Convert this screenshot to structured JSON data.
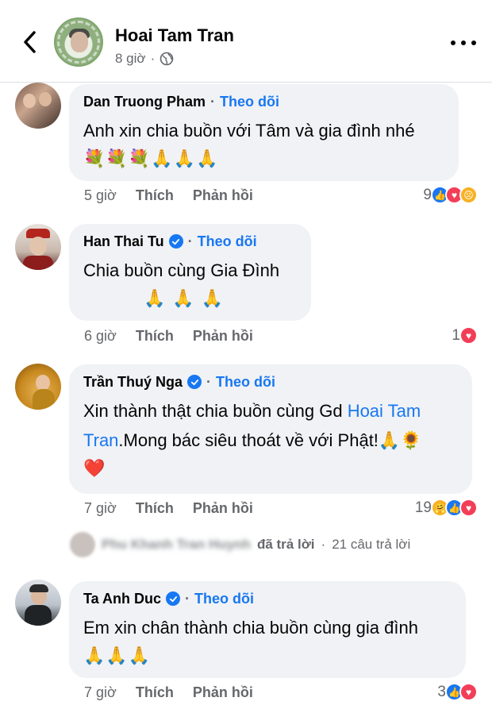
{
  "header": {
    "title": "Hoai Tam Tran",
    "time": "8 giờ",
    "avatar_text": "STOP ASIAN HATE"
  },
  "comments": [
    {
      "author": "Dan Truong Pham",
      "verified": false,
      "follow": "Theo dõi",
      "text": "Anh xin chia buồn với Tâm và gia đình nhé",
      "emojis": "💐💐💐🙏🙏🙏",
      "time": "5 giờ",
      "like": "Thích",
      "reply": "Phản hồi",
      "reaction_count": "9",
      "reactions": [
        "like",
        "love",
        "sad"
      ]
    },
    {
      "author": "Han Thai Tu",
      "verified": true,
      "follow": "Theo dõi",
      "text": "Chia buồn cùng Gia Đình",
      "emojis": "🙏 🙏 🙏",
      "time": "6 giờ",
      "like": "Thích",
      "reply": "Phản hồi",
      "reaction_count": "1",
      "reactions": [
        "love"
      ]
    },
    {
      "author": "Trần Thuý Nga",
      "verified": true,
      "follow": "Theo dõi",
      "text_before": "Xin thành thật chia buồn cùng Gd ",
      "mention": "Hoai Tam Tran",
      "text_after": ".Mong bác siêu thoát về với Phật!🙏🌻",
      "emojis": "❤️",
      "time": "7 giờ",
      "like": "Thích",
      "reply": "Phản hồi",
      "reaction_count": "19",
      "reactions": [
        "care",
        "like",
        "love"
      ]
    },
    {
      "author": "Ta Anh Duc",
      "verified": true,
      "follow": "Theo dõi",
      "text": "Em xin chân thành chia buồn cùng gia đình",
      "emojis": "🙏🙏🙏",
      "time": "7 giờ",
      "like": "Thích",
      "reply": "Phản hồi",
      "reaction_count": "3",
      "reactions": [
        "like",
        "love"
      ]
    }
  ],
  "reply_summary": {
    "name": "Phu Khanh Tran Huynh",
    "action": "đã trả lời",
    "count": "21 câu trả lời"
  },
  "colors": {
    "accent": "#1877f2",
    "bubble": "#f0f2f5",
    "muted": "#65676b",
    "love": "#f33e58"
  }
}
